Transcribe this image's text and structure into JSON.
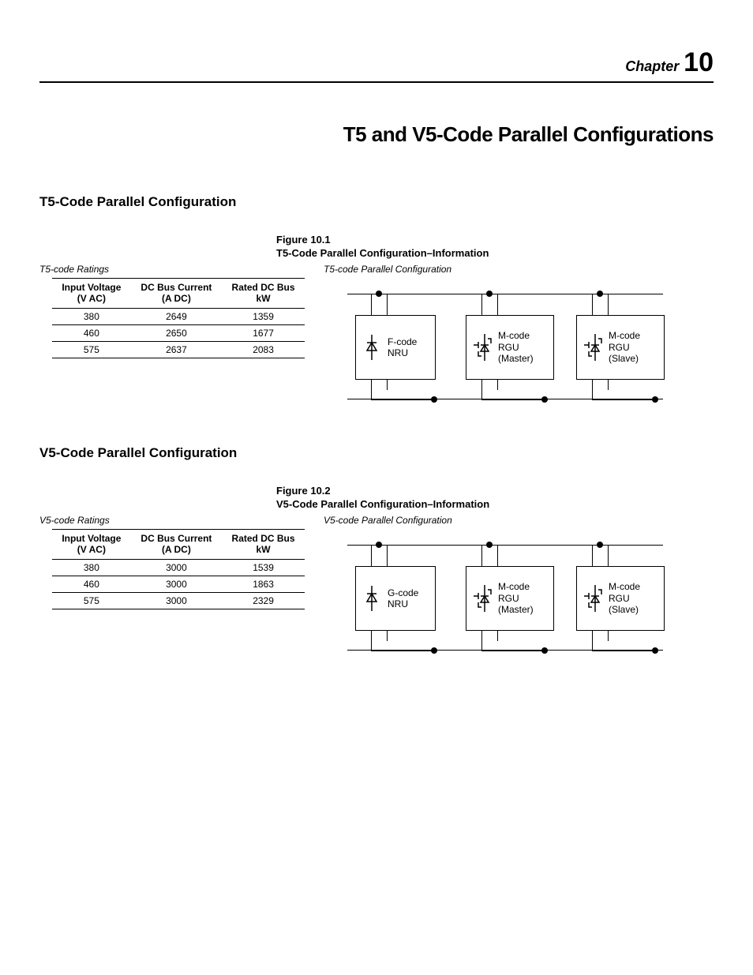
{
  "chapter": {
    "label": "Chapter",
    "number": "10"
  },
  "main_title": "T5 and V5-Code Parallel Configurations",
  "sections": {
    "t5": {
      "heading": "T5-Code Parallel Configuration",
      "figure_num": "Figure 10.1",
      "figure_title": "T5-Code Parallel Configuration–Information",
      "table_title": "T5-code Ratings",
      "diagram_title": "T5-code Parallel Configuration",
      "columns": {
        "c1a": "Input Voltage",
        "c1b": "(V AC)",
        "c2a": "DC Bus Current",
        "c2b": "(A DC)",
        "c3a": "Rated DC Bus",
        "c3b": "kW"
      },
      "rows": [
        {
          "v": "380",
          "a": "2649",
          "kw": "1359"
        },
        {
          "v": "460",
          "a": "2650",
          "kw": "1677"
        },
        {
          "v": "575",
          "a": "2637",
          "kw": "2083"
        }
      ],
      "units": {
        "u1a": "F-code",
        "u1b": "NRU",
        "u2a": "M-code",
        "u2b": "RGU",
        "u2c": "(Master)",
        "u3a": "M-code",
        "u3b": "RGU",
        "u3c": "(Slave)"
      }
    },
    "v5": {
      "heading": "V5-Code Parallel Configuration",
      "figure_num": "Figure 10.2",
      "figure_title": "V5-Code Parallel Configuration–Information",
      "table_title": "V5-code Ratings",
      "diagram_title": "V5-code Parallel Configuration",
      "columns": {
        "c1a": "Input Voltage",
        "c1b": "(V AC)",
        "c2a": "DC Bus Current",
        "c2b": "(A DC)",
        "c3a": "Rated DC Bus",
        "c3b": "kW"
      },
      "rows": [
        {
          "v": "380",
          "a": "3000",
          "kw": "1539"
        },
        {
          "v": "460",
          "a": "3000",
          "kw": "1863"
        },
        {
          "v": "575",
          "a": "3000",
          "kw": "2329"
        }
      ],
      "units": {
        "u1a": "G-code",
        "u1b": "NRU",
        "u2a": "M-code",
        "u2b": "RGU",
        "u2c": "(Master)",
        "u3a": "M-code",
        "u3b": "RGU",
        "u3c": "(Slave)"
      }
    }
  },
  "chart_data": [
    {
      "type": "table",
      "title": "T5-code Ratings",
      "columns": [
        "Input Voltage (V AC)",
        "DC Bus Current (A DC)",
        "Rated DC Bus kW"
      ],
      "rows": [
        [
          380,
          2649,
          1359
        ],
        [
          460,
          2650,
          1677
        ],
        [
          575,
          2637,
          2083
        ]
      ]
    },
    {
      "type": "table",
      "title": "V5-code Ratings",
      "columns": [
        "Input Voltage (V AC)",
        "DC Bus Current (A DC)",
        "Rated DC Bus kW"
      ],
      "rows": [
        [
          380,
          3000,
          1539
        ],
        [
          460,
          3000,
          1863
        ],
        [
          575,
          3000,
          2329
        ]
      ]
    }
  ]
}
